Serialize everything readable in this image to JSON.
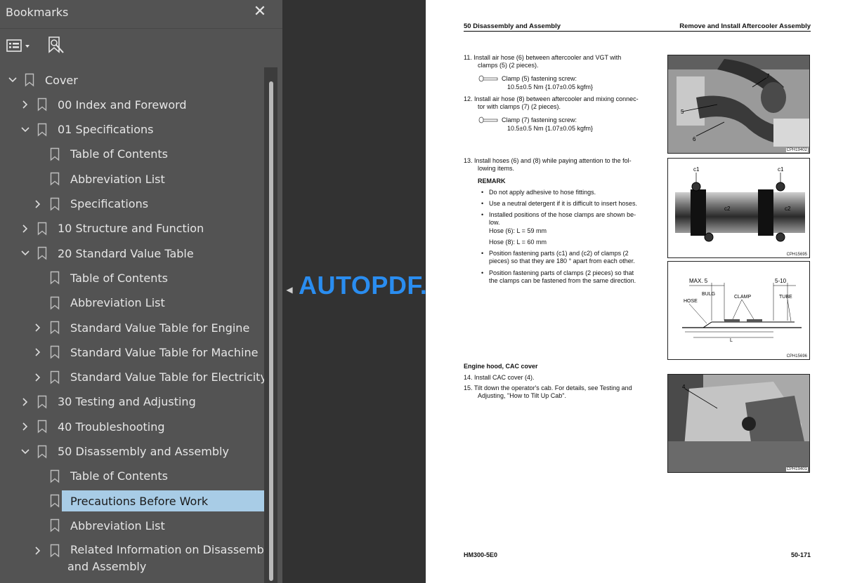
{
  "panel": {
    "title": "Bookmarks",
    "close_icon": "close-icon",
    "tools": [
      "options-menu-icon",
      "find-bookmark-icon"
    ],
    "items": [
      {
        "label": "Cover",
        "level": 0,
        "state": "expanded"
      },
      {
        "label": "00 Index and Foreword",
        "level": 1,
        "state": "collapsed"
      },
      {
        "label": "01 Specifications",
        "level": 1,
        "state": "expanded"
      },
      {
        "label": "Table of Contents",
        "level": 2,
        "state": "leaf"
      },
      {
        "label": "Abbreviation List",
        "level": 2,
        "state": "leaf"
      },
      {
        "label": "Specifications",
        "level": 2,
        "state": "collapsed"
      },
      {
        "label": "10 Structure and Function",
        "level": 1,
        "state": "collapsed"
      },
      {
        "label": "20 Standard Value Table",
        "level": 1,
        "state": "expanded"
      },
      {
        "label": "Table of Contents",
        "level": 2,
        "state": "leaf"
      },
      {
        "label": "Abbreviation List",
        "level": 2,
        "state": "leaf"
      },
      {
        "label": "Standard Value Table for Engine",
        "level": 2,
        "state": "collapsed"
      },
      {
        "label": "Standard Value Table for Machine",
        "level": 2,
        "state": "collapsed"
      },
      {
        "label": "Standard Value Table for Electricity",
        "level": 2,
        "state": "collapsed"
      },
      {
        "label": "30 Testing and Adjusting",
        "level": 1,
        "state": "collapsed"
      },
      {
        "label": "40 Troubleshooting",
        "level": 1,
        "state": "collapsed"
      },
      {
        "label": "50 Disassembly and Assembly",
        "level": 1,
        "state": "expanded"
      },
      {
        "label": "Table of Contents",
        "level": 2,
        "state": "leaf"
      },
      {
        "label": "Precautions Before Work",
        "level": 2,
        "state": "leaf",
        "selected": true
      },
      {
        "label": "Abbreviation List",
        "level": 2,
        "state": "leaf"
      },
      {
        "label": "Related Information on Disassembly",
        "label2": "and Assembly",
        "level": 2,
        "state": "collapsed"
      }
    ]
  },
  "watermark": "AUTOPDF.NET",
  "document": {
    "header_left": "50 Disassembly and Assembly",
    "header_right": "Remove and Install Aftercooler Assembly",
    "step11": "11.  Install air hose (6) between aftercooler and VGT with",
    "step11b": "clamps (5) (2 pieces).",
    "torque11": "Clamp (5) fastening screw:",
    "torque11v": "10.5±0.5 Nm {1.07±0.05 kgfm}",
    "step12": "12.  Install air hose (8) between aftercooler and mixing connec-",
    "step12b": "tor with clamps (7) (2 pieces).",
    "torque12": "Clamp (7) fastening screw:",
    "torque12v": "10.5±0.5 Nm {1.07±0.05 kgfm}",
    "step13": "13.  Install hoses (6) and (8) while paying attention to the fol-",
    "step13b": "lowing items.",
    "remark": "REMARK",
    "bullets": [
      "Do not apply adhesive to hose fittings.",
      "Use a neutral detergent if it is difficult to insert hoses.",
      "Installed positions of the hose clamps are shown be-",
      "low.",
      "Hose (6): L = 59 mm",
      "Hose (8): L = 60 mm",
      "Position fastening parts (c1) and (c2) of clamps (2",
      "pieces) so that they are 180 ° apart from each other.",
      "Position fastening parts of clamps (2 pieces) so that",
      "the clamps can be fastened from the same direction."
    ],
    "section_title": "Engine hood, CAC cover",
    "step14": "14.  Install CAC cover (4).",
    "step15": "15.  Tilt down the operator's cab. For details, see Testing and",
    "step15b": "Adjusting, \"How to Tilt Up Cab\".",
    "footer_left": "HM300-5E0",
    "footer_right": "50-171",
    "fig1_caption": "CPH19402",
    "fig1_labels": [
      "5",
      "6",
      "7"
    ],
    "fig2_caption": "CPH15695",
    "fig2_labels": [
      "c1",
      "c1",
      "c2",
      "c2"
    ],
    "fig3_caption": "CPH15696",
    "fig3_labels": [
      "MAX. 5",
      "5-10",
      "BULG",
      "CLAMP",
      "HOSE",
      "TUBE",
      "L"
    ],
    "fig4_caption": "CPH19401",
    "fig4_labels": [
      "4"
    ]
  }
}
